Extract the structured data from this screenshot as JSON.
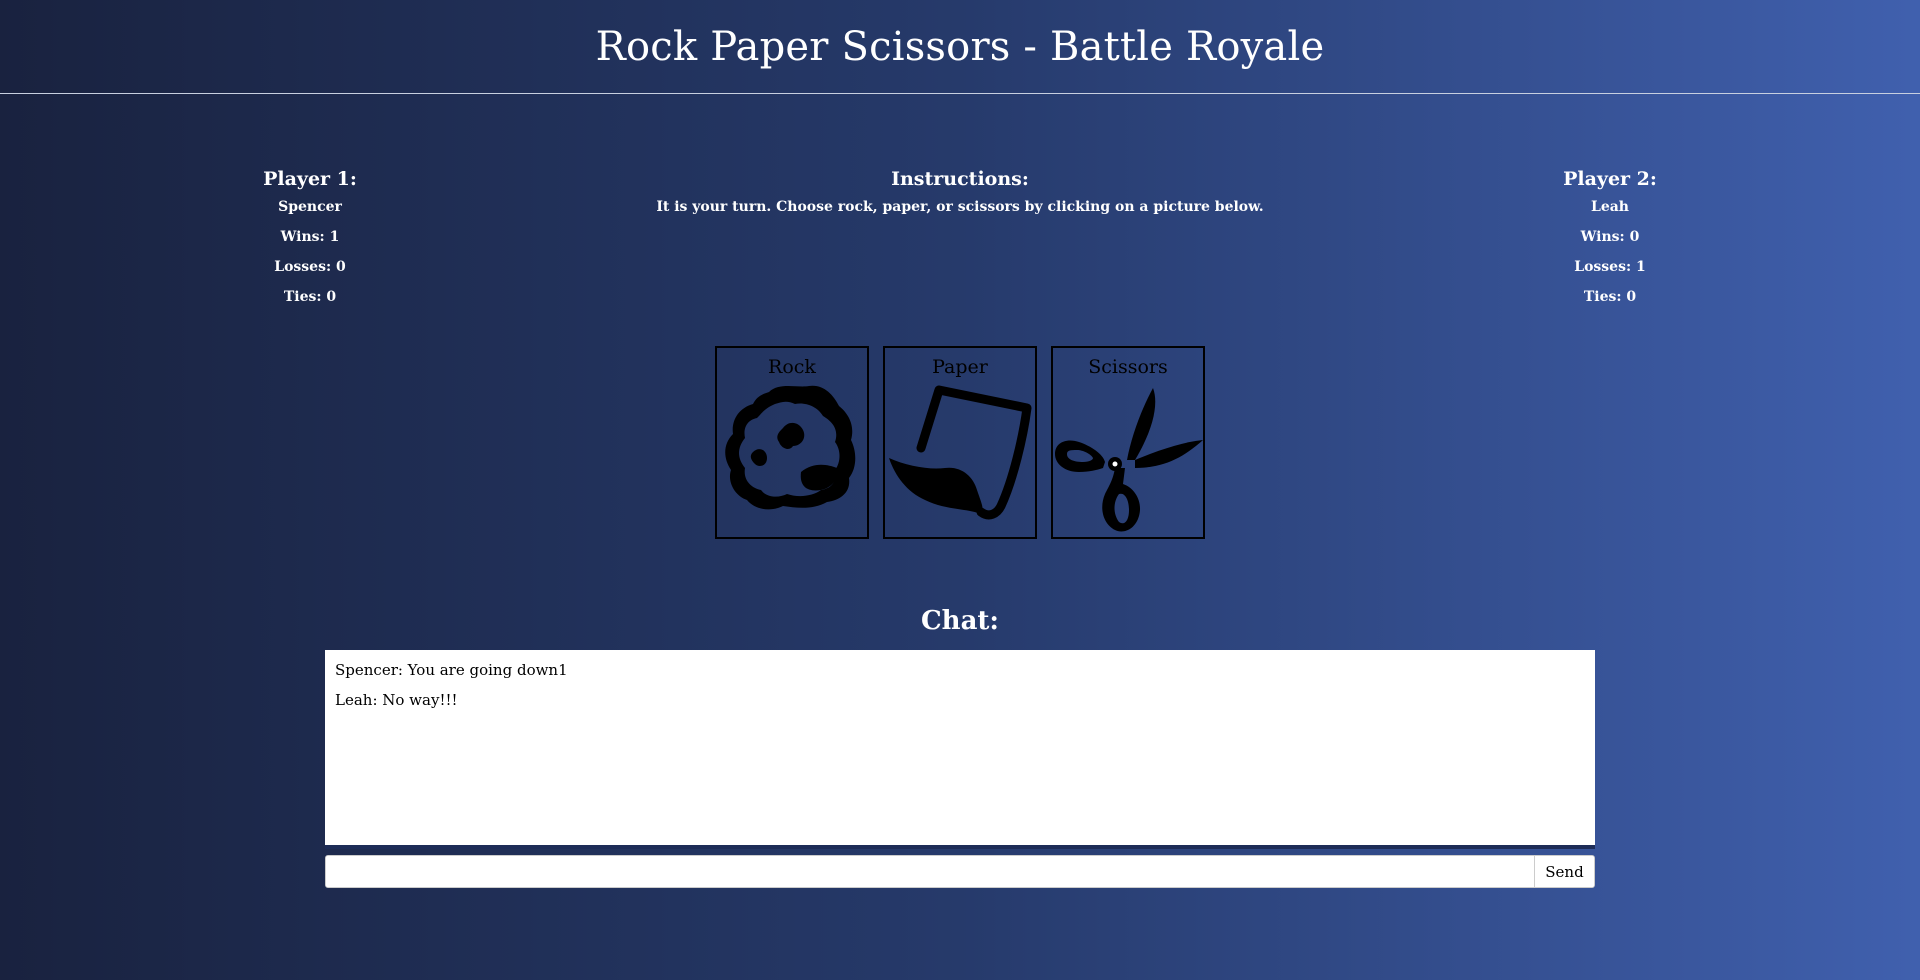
{
  "header": {
    "title": "Rock Paper Scissors - Battle Royale"
  },
  "player1": {
    "heading": "Player 1:",
    "name": "Spencer",
    "wins": "Wins: 1",
    "losses": "Losses: 0",
    "ties": "Ties: 0"
  },
  "player2": {
    "heading": "Player 2:",
    "name": "Leah",
    "wins": "Wins: 0",
    "losses": "Losses: 1",
    "ties": "Ties: 0"
  },
  "instructions": {
    "heading": "Instructions:",
    "text": "It is your turn. Choose rock, paper, or scissors by clicking on a picture below."
  },
  "choices": [
    {
      "label": "Rock",
      "icon": "rock-icon"
    },
    {
      "label": "Paper",
      "icon": "paper-icon"
    },
    {
      "label": "Scissors",
      "icon": "scissors-icon"
    }
  ],
  "chat": {
    "title": "Chat:",
    "messages": [
      "Spencer: You are going down1",
      "Leah: No way!!!"
    ],
    "input_value": "",
    "send_label": "Send"
  }
}
